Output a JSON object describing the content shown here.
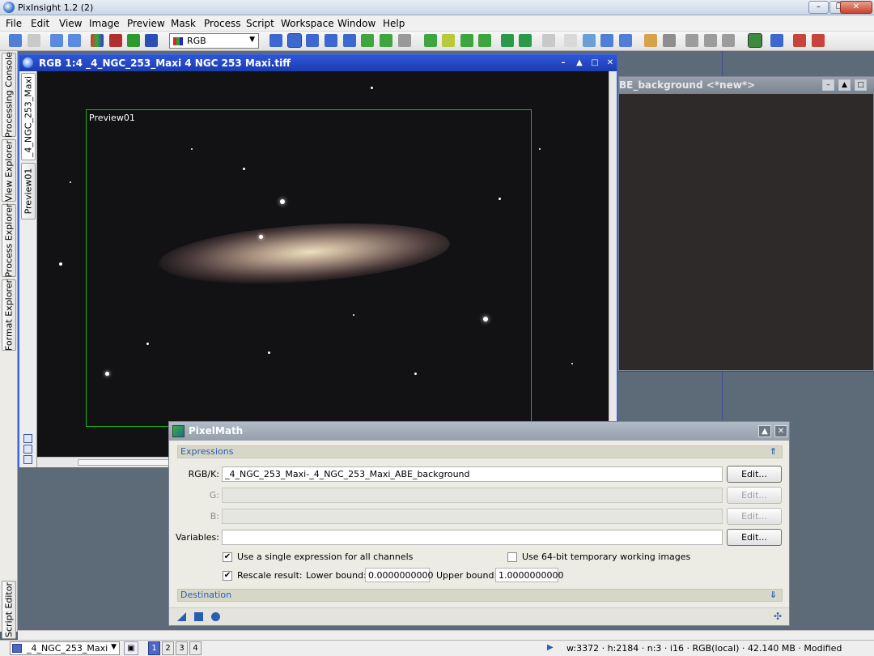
{
  "app": {
    "title": "PixInsight 1.2 (2)",
    "min": "–",
    "max": "❐",
    "close": "✕"
  },
  "menu": [
    "File",
    "Edit",
    "View",
    "Image",
    "Preview",
    "Mask",
    "Process",
    "Script",
    "Workspace",
    "Window",
    "Help"
  ],
  "toolbar": {
    "color_space": "RGB"
  },
  "left_tabs": [
    "Processing Console",
    "View Explorer",
    "Process Explorer",
    "Format Explorer",
    "Script Editor"
  ],
  "image_window": {
    "title": "RGB 1:4 _4_NGC_253_Maxi 4 NGC 253 Maxi.tiff",
    "tabs": [
      "_4_NGC_253_Maxi",
      "Preview01"
    ],
    "preview_label": "Preview01"
  },
  "second_window": {
    "title": "BE_background <*new*>"
  },
  "pixelmath": {
    "title": "PixelMath",
    "expressions_section": "Expressions",
    "rgbk_label": "RGB/K:",
    "rgbk_value": "_4_NGC_253_Maxi-_4_NGC_253_Maxi_ABE_background",
    "g_label": "G:",
    "b_label": "B:",
    "variables_label": "Variables:",
    "edit_label": "Edit...",
    "single_expression_label": "Use a single expression for all channels",
    "single_expression_checked": true,
    "use64_label": "Use 64-bit temporary working images",
    "use64_checked": false,
    "rescale_label": "Rescale result:",
    "rescale_checked": true,
    "lower_bound_label": "Lower bound:",
    "lower_bound_value": "0.0000000000",
    "upper_bound_label": "Upper bound:",
    "upper_bound_value": "1.0000000000",
    "destination_section": "Destination"
  },
  "statusbar": {
    "view": "_4_NGC_253_Maxi",
    "workspaces": [
      "1",
      "2",
      "3",
      "4"
    ],
    "active_workspace": "1",
    "info": "w:3372 · h:2184 · n:3 · i16 · RGB(local) · 42.140 MB · Modified"
  }
}
